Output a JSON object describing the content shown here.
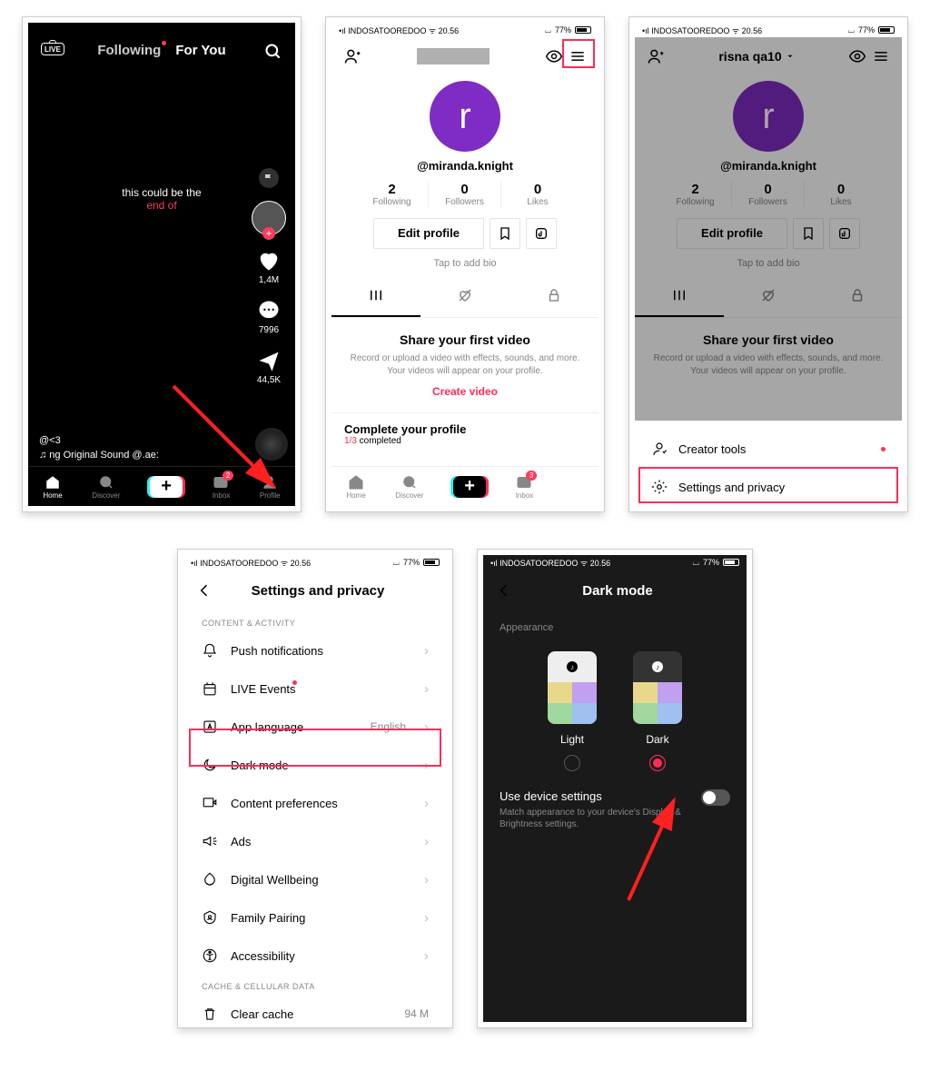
{
  "feed": {
    "following": "Following",
    "foryou": "For You",
    "live": "LIVE",
    "caption_line1": "this could be the",
    "caption_line2": "end of",
    "likes": "1,4M",
    "comments": "7996",
    "shares": "44,5K",
    "user": "@<3",
    "sound": "♫ ng Original Sound   @.ae:",
    "nav_home": "Home",
    "nav_discover": "Discover",
    "nav_inbox": "Inbox",
    "nav_profile": "Profile",
    "inbox_badge": "2"
  },
  "status": {
    "carrier": "INDOSATOOREDOO",
    "time": "20.56",
    "batt": "77%"
  },
  "profile": {
    "name_dropdown": "risna qa10",
    "handle": "@miranda.knight",
    "avatar_letter": "r",
    "following_n": "2",
    "following_l": "Following",
    "followers_n": "0",
    "followers_l": "Followers",
    "likes_n": "0",
    "likes_l": "Likes",
    "edit": "Edit profile",
    "bio": "Tap to add bio",
    "share_h": "Share your first video",
    "share_p": "Record or upload a video with effects, sounds, and more. Your videos will appear on your profile.",
    "create": "Create video",
    "complete_h": "Complete your profile",
    "complete_done": "1/3",
    "complete_suffix": " completed",
    "inbox_badge": "3"
  },
  "sheet": {
    "creator": "Creator tools",
    "settings": "Settings and privacy"
  },
  "settings": {
    "title": "Settings and privacy",
    "section_ca": "CONTENT & ACTIVITY",
    "push": "Push notifications",
    "live": "LIVE Events",
    "lang": "App language",
    "lang_val": "English",
    "dark": "Dark mode",
    "content": "Content preferences",
    "ads": "Ads",
    "well": "Digital Wellbeing",
    "family": "Family Pairing",
    "access": "Accessibility",
    "section_cache": "CACHE & CELLULAR DATA",
    "clear": "Clear cache",
    "clear_val": "94 M"
  },
  "darkmode": {
    "title": "Dark mode",
    "appearance": "Appearance",
    "light": "Light",
    "dark": "Dark",
    "device_h": "Use device settings",
    "device_sub": "Match appearance to your device's Display & Brightness settings."
  }
}
